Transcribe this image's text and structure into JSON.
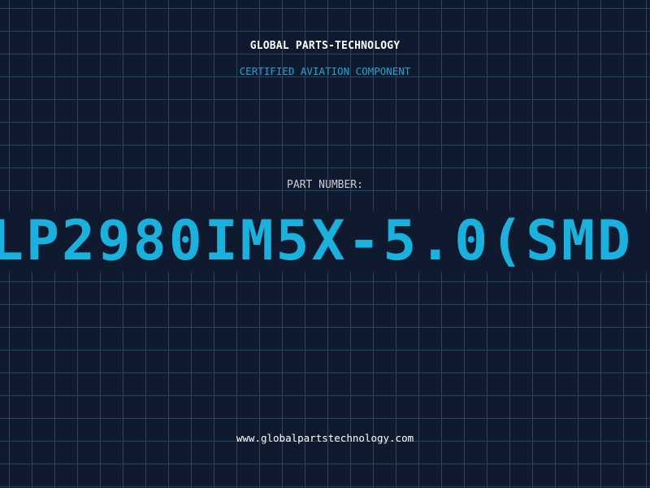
{
  "header": {
    "brand": "GLOBAL PARTS-TECHNOLOGY",
    "tagline": "CERTIFIED AVIATION COMPONENT"
  },
  "part": {
    "label": "PART NUMBER:",
    "number": "LP2980IM5X-5.0(SMD"
  },
  "footer": {
    "url": "www.globalpartstechnology.com"
  },
  "colors": {
    "background": "#101a2e",
    "grid": "#1d4a66",
    "accent": "#19b2de",
    "text": "#ffffff"
  }
}
